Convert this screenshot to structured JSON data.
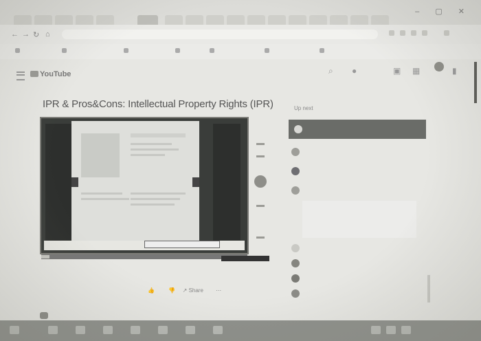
{
  "browser": {
    "url": "",
    "bookmarks": [
      "",
      "",
      "",
      "",
      "",
      "",
      ""
    ]
  },
  "youtube": {
    "logo": "YouTube",
    "search_placeholder": ""
  },
  "video": {
    "title": "IPR & Pros&Cons: Intellectual Property Rights (IPR)",
    "description": "",
    "channel": "",
    "like_count": "",
    "share_label": "Share"
  },
  "sidebar": {
    "up_next_label": "Up next",
    "playlist_title": "",
    "items": [
      "",
      "",
      "",
      "",
      "",
      "",
      "",
      ""
    ]
  },
  "taskbar": {
    "clock": ""
  }
}
